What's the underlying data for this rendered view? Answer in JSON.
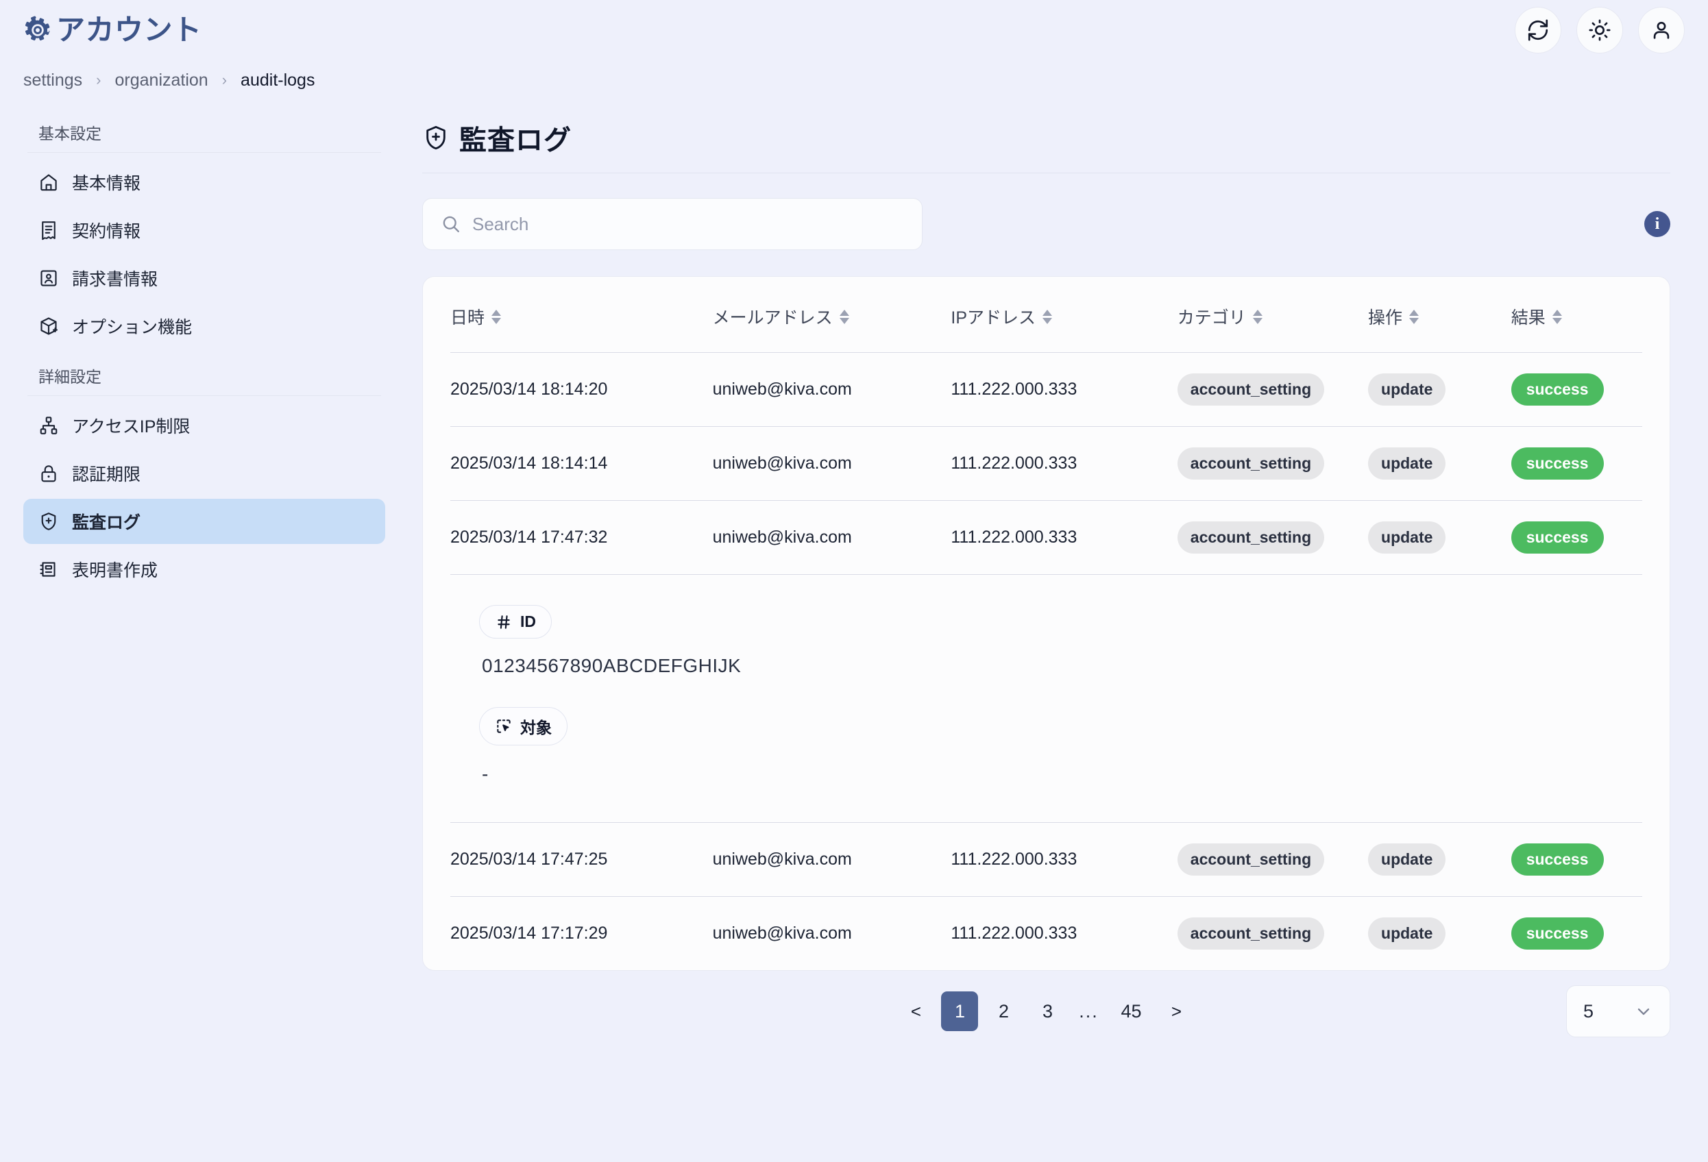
{
  "header": {
    "title": "アカウント",
    "actions": [
      {
        "name": "refresh-button",
        "icon": "refresh-icon"
      },
      {
        "name": "theme-button",
        "icon": "sun-icon"
      },
      {
        "name": "account-button",
        "icon": "user-icon"
      }
    ]
  },
  "breadcrumb": {
    "items": [
      "settings",
      "organization",
      "audit-logs"
    ],
    "separator": "›"
  },
  "sidebar": {
    "groups": [
      {
        "label": "基本設定",
        "items": [
          {
            "label": "基本情報",
            "icon": "home-icon",
            "active": false
          },
          {
            "label": "契約情報",
            "icon": "receipt-icon",
            "active": false
          },
          {
            "label": "請求書情報",
            "icon": "invoice-user-icon",
            "active": false
          },
          {
            "label": "オプション機能",
            "icon": "package-plus-icon",
            "active": false
          }
        ]
      },
      {
        "label": "詳細設定",
        "items": [
          {
            "label": "アクセスIP制限",
            "icon": "network-icon",
            "active": false
          },
          {
            "label": "認証期限",
            "icon": "lock-icon",
            "active": false
          },
          {
            "label": "監査ログ",
            "icon": "shield-plus-icon",
            "active": true
          },
          {
            "label": "表明書作成",
            "icon": "document-list-icon",
            "active": false
          }
        ]
      }
    ]
  },
  "main": {
    "title": "監査ログ",
    "title_icon": "shield-plus-icon",
    "search": {
      "value": "",
      "placeholder": "Search",
      "icon": "search-icon"
    },
    "info_icon_label": "i",
    "table": {
      "columns": [
        {
          "label": "日時",
          "key": "datetime",
          "sortable": true
        },
        {
          "label": "メールアドレス",
          "key": "email",
          "sortable": true
        },
        {
          "label": "IPアドレス",
          "key": "ip",
          "sortable": true
        },
        {
          "label": "カテゴリ",
          "key": "category",
          "sortable": true
        },
        {
          "label": "操作",
          "key": "operation",
          "sortable": true
        },
        {
          "label": "結果",
          "key": "result",
          "sortable": true
        }
      ],
      "rows": [
        {
          "datetime": "2025/03/14 18:14:20",
          "email": "uniweb@kiva.com",
          "ip": "111.222.000.333",
          "category": "account_setting",
          "operation": "update",
          "result": "success"
        },
        {
          "datetime": "2025/03/14 18:14:14",
          "email": "uniweb@kiva.com",
          "ip": "111.222.000.333",
          "category": "account_setting",
          "operation": "update",
          "result": "success"
        },
        {
          "datetime": "2025/03/14 17:47:32",
          "email": "uniweb@kiva.com",
          "ip": "111.222.000.333",
          "category": "account_setting",
          "operation": "update",
          "result": "success"
        },
        {
          "datetime": "2025/03/14 17:47:25",
          "email": "uniweb@kiva.com",
          "ip": "111.222.000.333",
          "category": "account_setting",
          "operation": "update",
          "result": "success"
        },
        {
          "datetime": "2025/03/14 17:17:29",
          "email": "uniweb@kiva.com",
          "ip": "111.222.000.333",
          "category": "account_setting",
          "operation": "update",
          "result": "success"
        }
      ],
      "expanded_detail": {
        "id_label": "ID",
        "id_icon": "hash-icon",
        "id_value": "01234567890ABCDEFGHIJK",
        "target_label": "対象",
        "target_icon": "select-object-icon",
        "target_value": "-"
      }
    }
  },
  "pagination": {
    "prev": "<",
    "next": ">",
    "pages": [
      "1",
      "2",
      "3"
    ],
    "ellipsis": "...",
    "last_page": "45",
    "current": "1",
    "page_size": "5"
  },
  "colors": {
    "background": "#eef0fb",
    "brand": "#3c5488",
    "active_nav": "#c7ddf7",
    "success": "#4cbb60",
    "chip": "#e6e6e8",
    "pager_active": "#4e6394",
    "info": "#44568f"
  }
}
